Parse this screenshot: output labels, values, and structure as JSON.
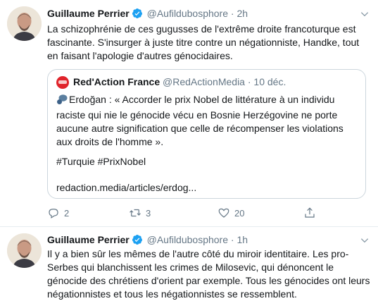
{
  "tweets": [
    {
      "author": {
        "name": "Guillaume Perrier",
        "handle": "@Aufildubosphore"
      },
      "separator": "·",
      "time": "2h",
      "text": "La schizophrénie de ces gugusses de l'extrême droite francoturque est fascinante. S'insurger à juste titre contre un négationniste, Handke, tout en faisant l'apologie d'autres génocidaires.",
      "quote": {
        "name": "Red'Action France",
        "handle": "@RedActionMedia",
        "separator": "·",
        "time": "10 déc.",
        "text": "Erdoğan : « Accorder le prix Nobel de littérature à un individu raciste qui nie le génocide vécu en Bosnie Herzégovine ne porte aucune autre signification que celle de récompenser les violations aux droits de l'homme ».",
        "hashtags": "#Turquie #PrixNobel",
        "link": "redaction.media/articles/erdog..."
      },
      "actions": {
        "replies": "2",
        "retweets": "3",
        "likes": "20"
      }
    },
    {
      "author": {
        "name": "Guillaume Perrier",
        "handle": "@Aufildubosphore"
      },
      "separator": "·",
      "time": "1h",
      "text": "Il y a bien sûr les mêmes de l'autre côté du miroir identitaire. Les pro-Serbes qui blanchissent les crimes de Milosevic, qui dénoncent le génocide des chrétiens d'orient par exemple. Tous les génocides ont leurs négationnistes et tous les négationnistes se ressemblent."
    }
  ],
  "icons": {
    "verified": "verified-badge-icon",
    "chevron": "chevron-down-icon",
    "speech": "speech-bubble-icon",
    "reply": "reply-icon",
    "retweet": "retweet-icon",
    "like": "heart-icon",
    "share": "share-icon"
  },
  "colors": {
    "verified": "#1da1f2",
    "secondary_text": "#657786",
    "border": "#ccd6dd",
    "redaction_logo": "#e0242b"
  }
}
